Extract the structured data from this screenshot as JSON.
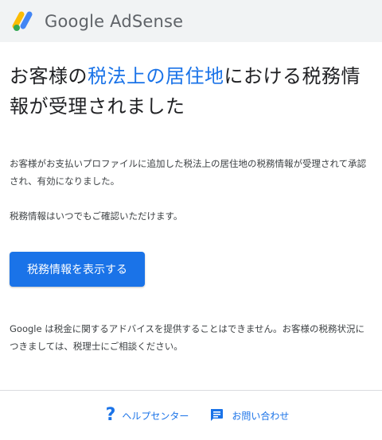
{
  "header": {
    "brand": "Google AdSense",
    "logo_colors": [
      "#FBBC04",
      "#4285F4",
      "#34A853"
    ]
  },
  "main": {
    "headline_pre": "お客様の",
    "headline_accent": "税法上の居住地",
    "headline_post": "における税務情報が受理されました",
    "para1": "お客様がお支払いプロファイルに追加した税法上の居住地の税務情報が受理されて承認され、有効になりました。",
    "para2": "税務情報はいつでもご確認いただけます。",
    "cta_label": "税務情報を表示する",
    "para3": "Google は税金に関するアドバイスを提供することはできません。お客様の税務状況につきましては、税理士にご相談ください。"
  },
  "footer": {
    "help_icon": "?",
    "help_label": "ヘルプセンター",
    "contact_label": "お問い合わせ"
  },
  "colors": {
    "accent": "#1a73e8",
    "header_bg": "#f1f3f4"
  }
}
